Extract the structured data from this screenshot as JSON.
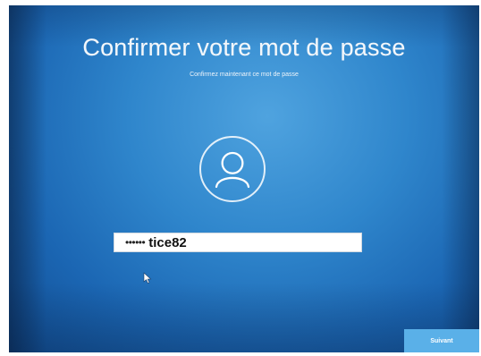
{
  "page": {
    "title": "Confirmer votre mot de passe",
    "subtitle": "Confirmez maintenant ce mot de passe"
  },
  "password_field": {
    "masked_value": "••••••",
    "value": "tice82"
  },
  "icons": {
    "avatar": "user-icon",
    "pointer": "mouse-pointer-icon"
  },
  "buttons": {
    "next_label": "Suivant"
  },
  "colors": {
    "background": "#2f86cc",
    "button": "#5ab0e8",
    "text": "#ffffff"
  }
}
